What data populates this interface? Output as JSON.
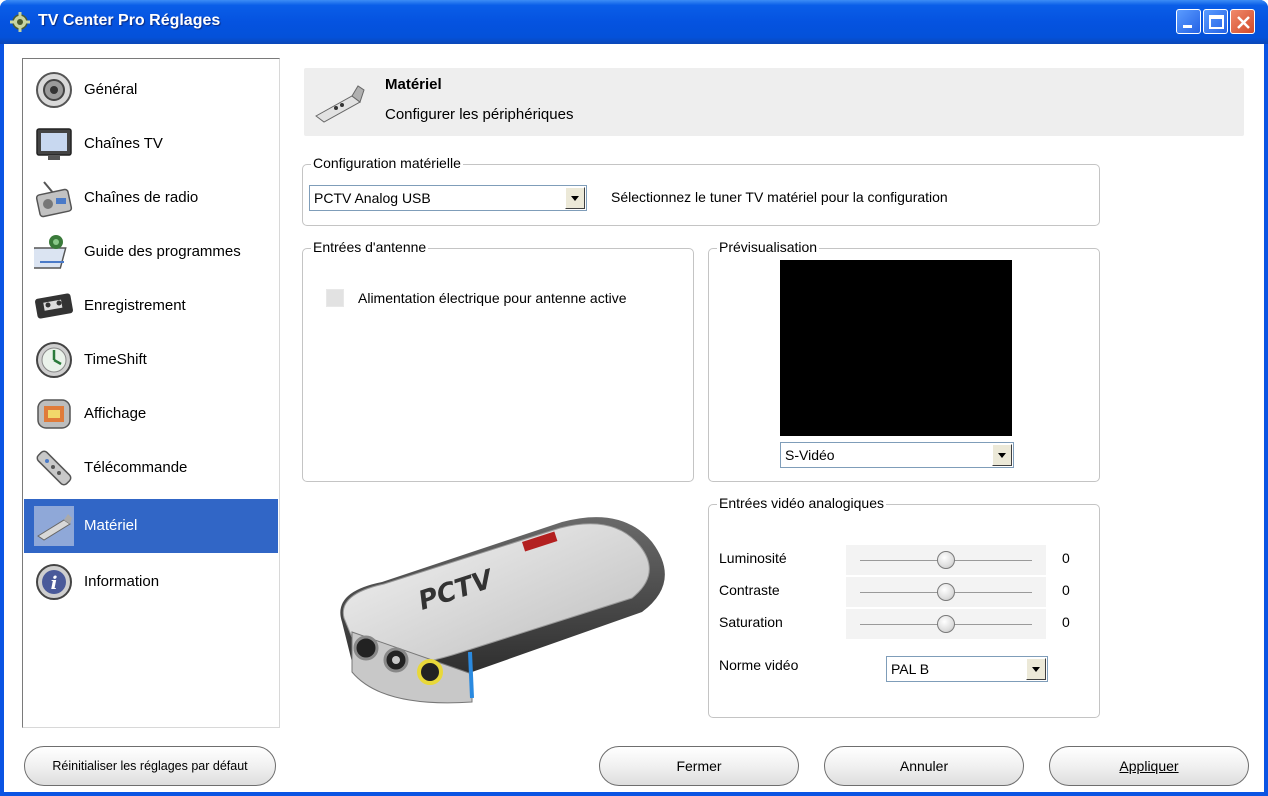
{
  "window": {
    "title": "TV Center Pro Réglages"
  },
  "sidebar": {
    "items": [
      {
        "label": "Général",
        "icon": "speaker-icon"
      },
      {
        "label": "Chaînes TV",
        "icon": "tv-monitor-icon"
      },
      {
        "label": "Chaînes de radio",
        "icon": "radio-icon"
      },
      {
        "label": "Guide des programmes",
        "icon": "program-guide-icon"
      },
      {
        "label": "Enregistrement",
        "icon": "vhs-tape-icon"
      },
      {
        "label": "TimeShift",
        "icon": "clock-icon"
      },
      {
        "label": "Affichage",
        "icon": "display-icon"
      },
      {
        "label": "Télécommande",
        "icon": "remote-control-icon"
      },
      {
        "label": "Matériel",
        "icon": "hardware-icon",
        "selected": true
      },
      {
        "label": "Information",
        "icon": "info-icon"
      }
    ]
  },
  "header": {
    "title": "Matériel",
    "subtitle": "Configurer les périphériques"
  },
  "hardware_config": {
    "legend": "Configuration matérielle",
    "tuner_value": "PCTV Analog USB",
    "hint": "Sélectionnez le tuner TV matériel pour la configuration"
  },
  "antenna": {
    "legend": "Entrées d'antenne",
    "power_label": "Alimentation électrique pour antenne active",
    "power_checked": false
  },
  "preview": {
    "legend": "Prévisualisation",
    "source_value": "S-Vidéo"
  },
  "analog_video": {
    "legend": "Entrées vidéo analogiques",
    "brightness_label": "Luminosité",
    "brightness_value": "0",
    "contrast_label": "Contraste",
    "contrast_value": "0",
    "saturation_label": "Saturation",
    "saturation_value": "0",
    "slider_position_fraction": 0.5,
    "norm_label": "Norme vidéo",
    "norm_value": "PAL B"
  },
  "footer": {
    "reset_label": "Réinitialiser les réglages par défaut",
    "close_label": "Fermer",
    "cancel_label": "Annuler",
    "apply_label": "Appliquer"
  },
  "colors": {
    "titlebar": "#0553e0",
    "selection": "#3166c6",
    "header_bg": "#eeeeee"
  }
}
